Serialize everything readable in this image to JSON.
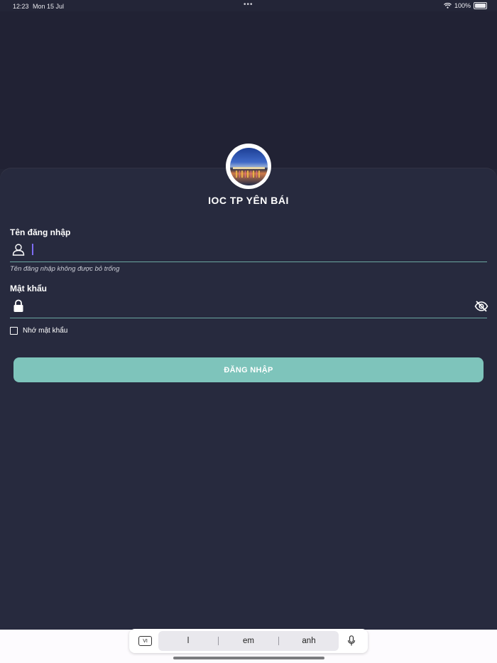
{
  "status_bar": {
    "time": "12:23",
    "date": "Mon 15 Jul",
    "dots": "•••",
    "battery_text": "100%"
  },
  "header": {
    "app_title": "IOC TP YÊN BÁI"
  },
  "form": {
    "username": {
      "label": "Tên đăng nhập",
      "value": "",
      "helper": "Tên đăng nhập không được bỏ trống"
    },
    "password": {
      "label": "Mật khẩu",
      "value": ""
    },
    "remember": {
      "label": "Nhớ mật khẩu",
      "checked": false
    },
    "login_label": "ĐĂNG NHẬP"
  },
  "keyboard": {
    "lang": "VI",
    "suggestions": [
      "l",
      "em",
      "anh"
    ]
  },
  "colors": {
    "accent": "#7ec4bb",
    "panel": "#272a3e",
    "background": "#212234",
    "caret": "#7d6cf2"
  }
}
